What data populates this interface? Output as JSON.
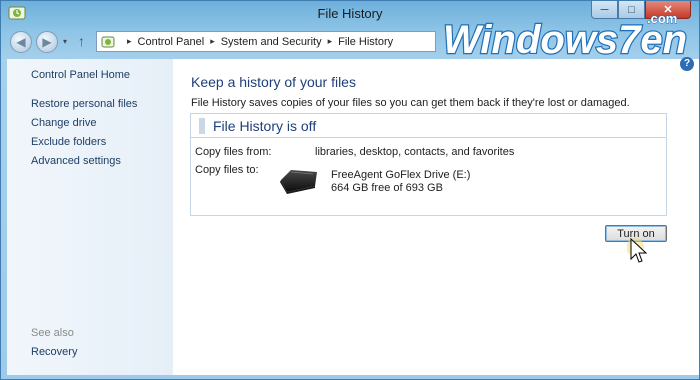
{
  "window": {
    "title": "File History",
    "caption": {
      "minimize": "─",
      "maximize": "□",
      "close": "✕"
    }
  },
  "watermark": {
    "text": "Windows7en",
    "suffix": ".com"
  },
  "nav": {
    "back_icon": "back-arrow-icon",
    "forward_icon": "forward-arrow-icon",
    "dropdown": "▾",
    "up": "↑",
    "breadcrumb": [
      "Control Panel",
      "System and Security",
      "File History"
    ],
    "separator": "▸"
  },
  "help": {
    "label": "?"
  },
  "sidebar": {
    "home": "Control Panel Home",
    "items": [
      {
        "label": "Restore personal files"
      },
      {
        "label": "Change drive"
      },
      {
        "label": "Exclude folders"
      },
      {
        "label": "Advanced settings"
      }
    ],
    "see_also_heading": "See also",
    "see_also": [
      {
        "label": "Recovery"
      }
    ]
  },
  "main": {
    "heading": "Keep a history of your files",
    "description": "File History saves copies of your files so you can get them back if they're lost or damaged.",
    "status_title": "File History is off",
    "copy_from_label": "Copy files from:",
    "copy_from_value": "libraries, desktop, contacts, and favorites",
    "copy_to_label": "Copy files to:",
    "drive_name": "FreeAgent GoFlex Drive (E:)",
    "drive_space": "664 GB free of 693 GB",
    "turn_on_button": "Turn on"
  },
  "colors": {
    "accent_heading": "#1e3f7a",
    "link": "#1e3f66",
    "title_bar": "#8ec4e6",
    "close_button": "#c5392a"
  }
}
